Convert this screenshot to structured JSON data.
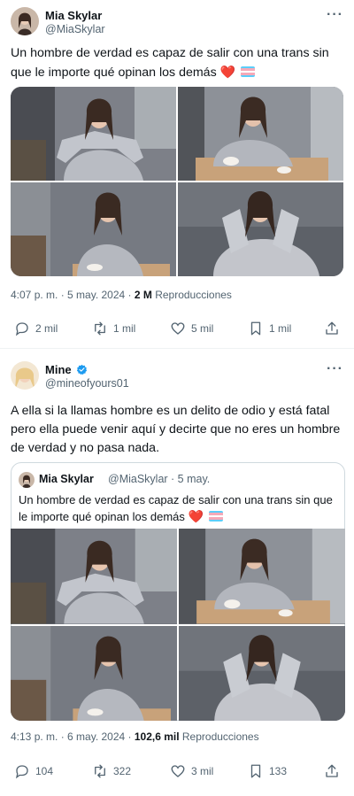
{
  "tweet1": {
    "author_name": "Mia Skylar",
    "author_handle": "@MiaSkylar",
    "more_icon": "more-dots-icon",
    "text": "Un hombre de verdad es capaz de salir con una trans sin que le importe qué opinan los demás",
    "emoji_heart": "❤️",
    "emoji_flag": "transgender-flag",
    "timestamp": "4:07 p. m. · 5 may. 2024 · ",
    "views_count": "2 M",
    "views_label": " Reproducciones",
    "actions": {
      "reply_count": "2 mil",
      "retweet_count": "1 mil",
      "like_count": "5 mil",
      "bookmark_count": "1 mil"
    }
  },
  "tweet2": {
    "author_name": "Mine",
    "author_handle": "@mineofyours01",
    "verified_icon": "verified-badge-icon",
    "text": "A ella si la llamas hombre es un delito de odio y está fatal pero ella puede venir aquí y decirte que no eres un hombre de verdad y no pasa nada.",
    "quote": {
      "author_name": "Mia Skylar",
      "author_handle": "@MiaSkylar · 5 may.",
      "text": "Un hombre de verdad es capaz de salir con una trans sin que le importe qué opinan los demás"
    },
    "timestamp": "4:13 p. m. · 6 may. 2024 · ",
    "views_count": "102,6 mil",
    "views_label": " Reproducciones",
    "actions": {
      "reply_count": "104",
      "retweet_count": "322",
      "like_count": "3 mil",
      "bookmark_count": "133"
    }
  },
  "colors": {
    "text_primary": "#0f1419",
    "text_secondary": "#536471",
    "verified_blue": "#1d9bf0",
    "heart_red": "#e0245e",
    "border": "#cfd9de"
  }
}
